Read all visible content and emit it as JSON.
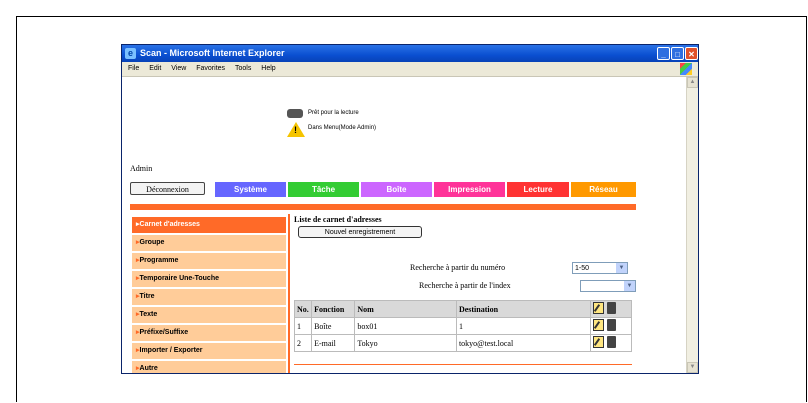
{
  "window": {
    "title": "Scan - Microsoft Internet Explorer",
    "controls": [
      "_",
      "□",
      "✕"
    ]
  },
  "menubar": {
    "items": [
      "File",
      "Edit",
      "View",
      "Favorites",
      "Tools",
      "Help"
    ]
  },
  "status": {
    "ready": "Prêt pour la lecture",
    "mode": "Dans Menu(Mode Admin)"
  },
  "user": {
    "label": "Admin"
  },
  "tabs": {
    "logout": "Déconnexion",
    "items": [
      {
        "label": "Système",
        "color": "#6666ff"
      },
      {
        "label": "Tâche",
        "color": "#33cc33"
      },
      {
        "label": "Boîte",
        "color": "#cc66ff"
      },
      {
        "label": "Impression",
        "color": "#ff3399"
      },
      {
        "label": "Lecture",
        "color": "#ff3333"
      },
      {
        "label": "Réseau",
        "color": "#ff9900"
      }
    ]
  },
  "sidebar": {
    "items": [
      {
        "label": "Carnet d'adresses",
        "active": true
      },
      {
        "label": "Groupe"
      },
      {
        "label": "Programme"
      },
      {
        "label": "Temporaire Une-Touche"
      },
      {
        "label": "Titre"
      },
      {
        "label": "Texte"
      },
      {
        "label": "Préfixe/Suffixe"
      },
      {
        "label": "Importer / Exporter"
      },
      {
        "label": "Autre"
      }
    ]
  },
  "main": {
    "title": "Liste de carnet d'adresses",
    "new_button": "Nouvel enregistrement",
    "search_number_label": "Recherche à partir du numéro",
    "search_number_value": "1-50",
    "search_index_label": "Recherche à partir de l'index",
    "search_index_value": "",
    "table": {
      "headers": [
        "No.",
        "Fonction",
        "Nom",
        "Destination"
      ],
      "rows": [
        [
          "1",
          "Boîte",
          "box01",
          "1"
        ],
        [
          "2",
          "E-mail",
          "Tokyo",
          "tokyo@test.local"
        ]
      ]
    }
  },
  "icons": {
    "printer": "printer-icon",
    "warning": "warning-icon",
    "edit": "edit-icon",
    "delete": "trash-icon"
  },
  "colors": {
    "accent": "#ff6a28",
    "sidebar_bg": "#ffcc99",
    "titlebar": "#0a4fd1"
  }
}
